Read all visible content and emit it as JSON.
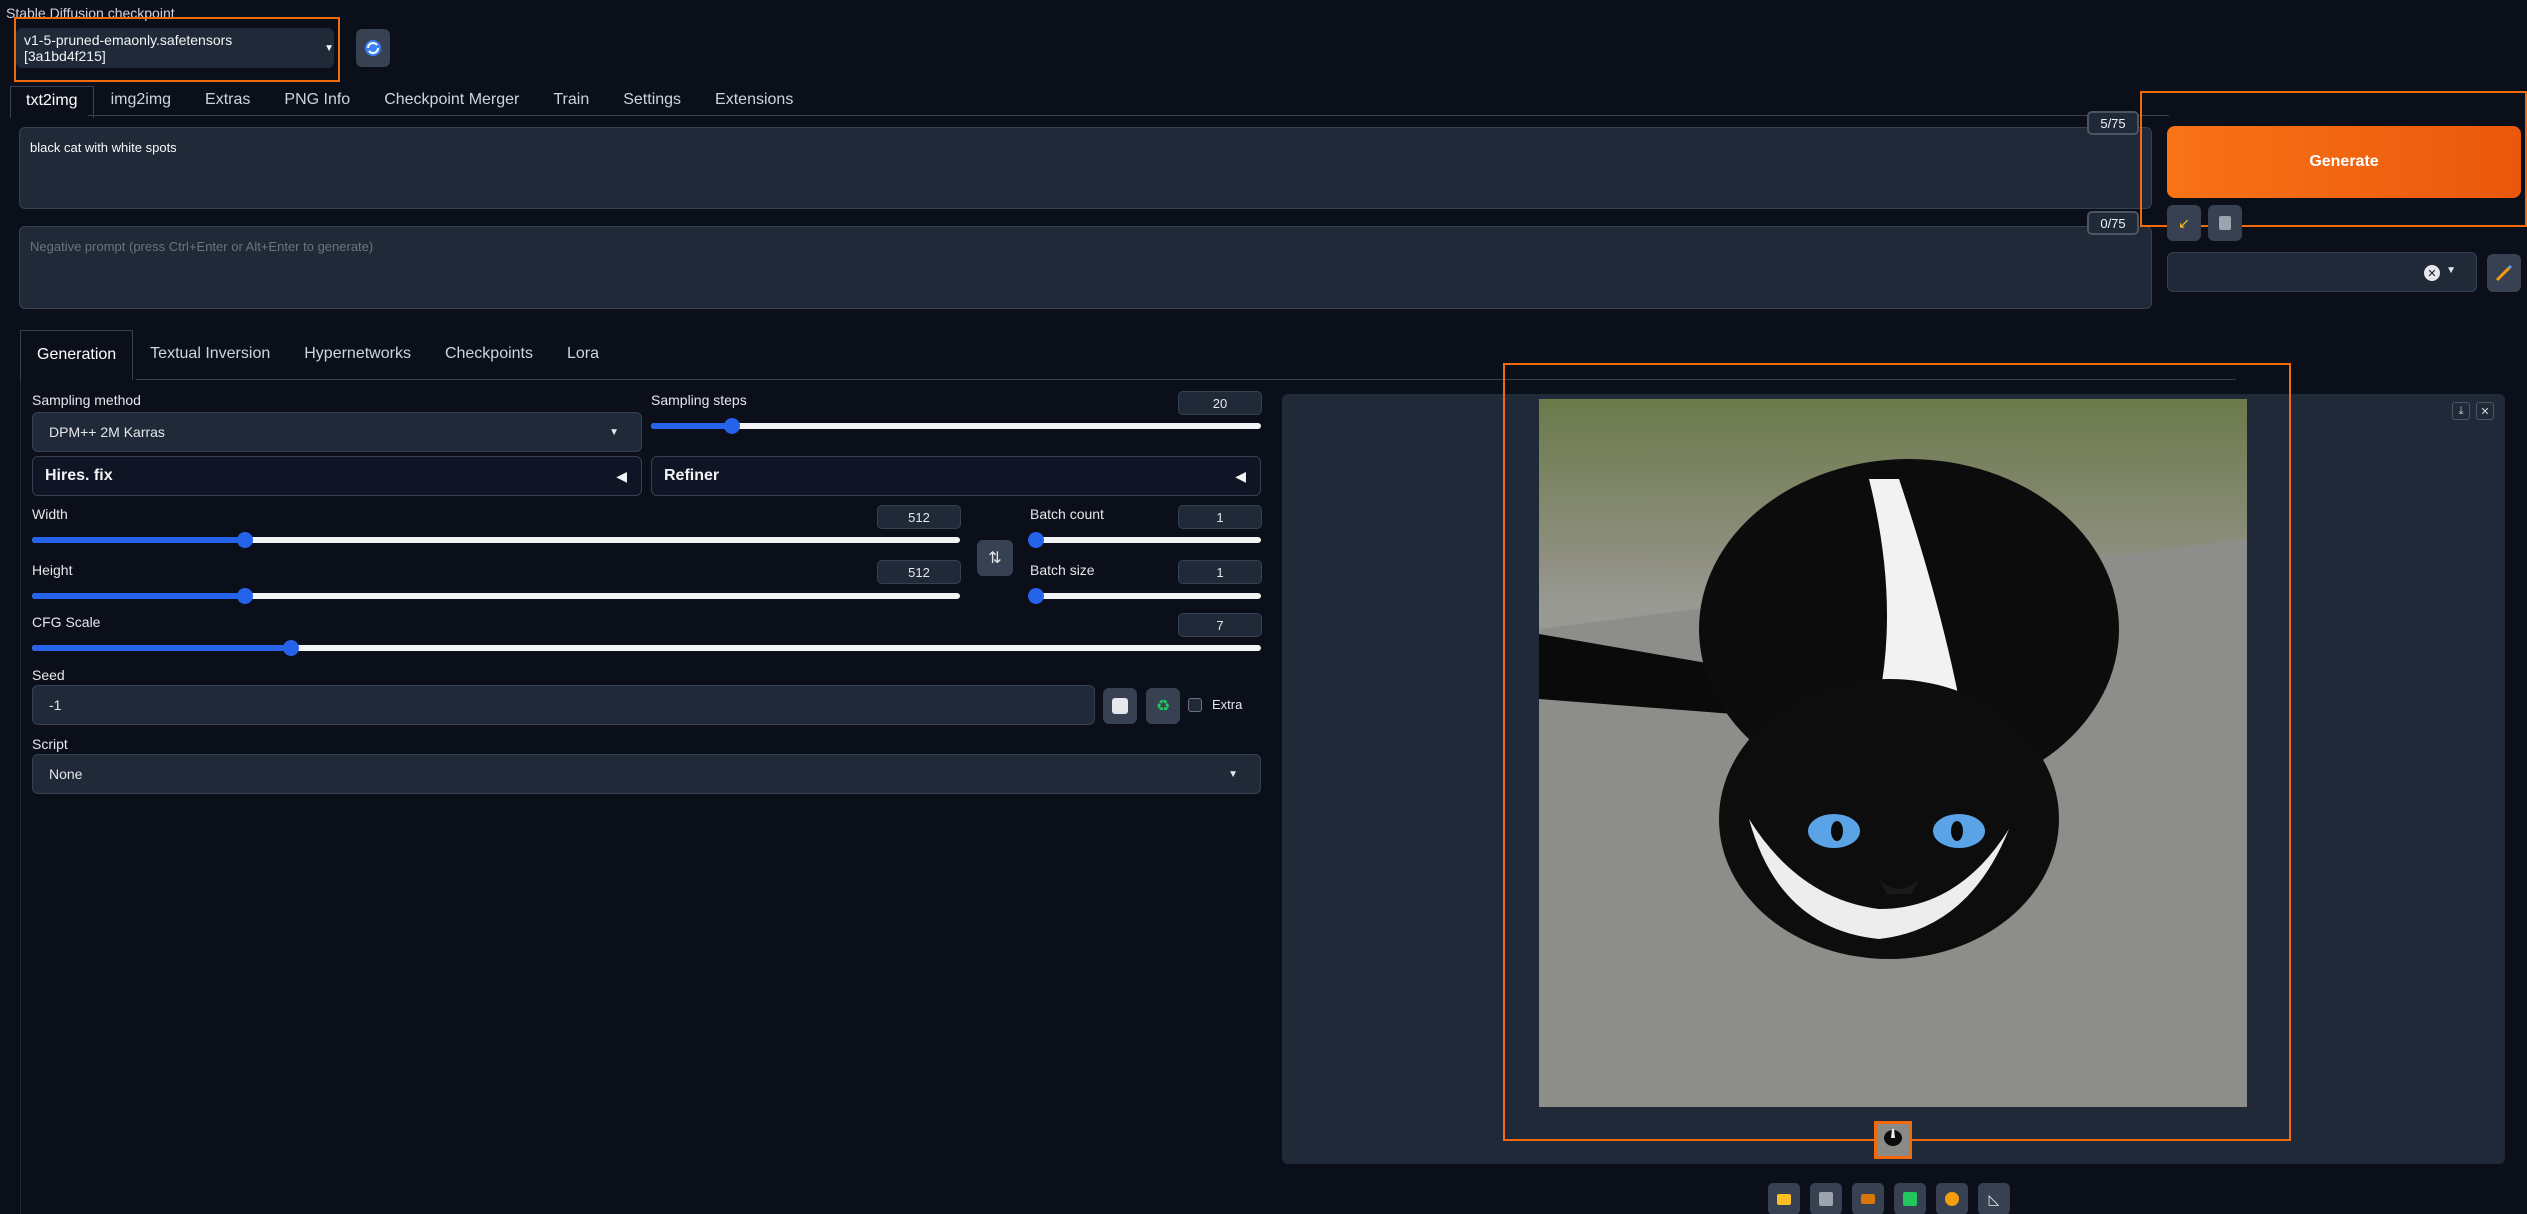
{
  "checkpoint": {
    "label": "Stable Diffusion checkpoint",
    "value": "v1-5-pruned-emaonly.safetensors [3a1bd4f215]"
  },
  "main_tabs": [
    {
      "label": "txt2img"
    },
    {
      "label": "img2img"
    },
    {
      "label": "Extras"
    },
    {
      "label": "PNG Info"
    },
    {
      "label": "Checkpoint Merger"
    },
    {
      "label": "Train"
    },
    {
      "label": "Settings"
    },
    {
      "label": "Extensions"
    }
  ],
  "prompt": {
    "value": "black cat with white spots",
    "token_count": "5/75"
  },
  "negative_prompt": {
    "placeholder": "Negative prompt (press Ctrl+Enter or Alt+Enter to generate)",
    "token_count": "0/75"
  },
  "generate_label": "Generate",
  "sub_tabs": [
    {
      "label": "Generation"
    },
    {
      "label": "Textual Inversion"
    },
    {
      "label": "Hypernetworks"
    },
    {
      "label": "Checkpoints"
    },
    {
      "label": "Lora"
    }
  ],
  "params": {
    "sampling_method": {
      "label": "Sampling method",
      "value": "DPM++ 2M Karras"
    },
    "sampling_steps": {
      "label": "Sampling steps",
      "value": "20",
      "fraction": 0.133
    },
    "hires_fix": "Hires. fix",
    "refiner": "Refiner",
    "width": {
      "label": "Width",
      "value": "512",
      "fraction": 0.23
    },
    "height": {
      "label": "Height",
      "value": "512",
      "fraction": 0.23
    },
    "batch_count": {
      "label": "Batch count",
      "value": "1",
      "fraction": 0.0
    },
    "batch_size": {
      "label": "Batch size",
      "value": "1",
      "fraction": 0.0
    },
    "cfg_scale": {
      "label": "CFG Scale",
      "value": "7",
      "fraction": 0.211
    },
    "seed": {
      "label": "Seed",
      "value": "-1"
    },
    "extra_label": "Extra",
    "script": {
      "label": "Script",
      "value": "None"
    }
  },
  "icons": {
    "refresh": "refresh-icon",
    "swap": "swap-dimensions-icon",
    "dice": "dice-icon",
    "recycle": "recycle-icon",
    "pencil": "pencil-icon",
    "folder": "folder-icon",
    "save": "save-icon",
    "zip": "zip-icon",
    "send_img2img": "image-icon",
    "send_inpaint": "palette-icon",
    "send_extras": "ruler-icon"
  },
  "colors": {
    "accent": "#f97316",
    "slider": "#2563eb",
    "background": "#0b0f19",
    "highlight": "#f26a0c"
  }
}
